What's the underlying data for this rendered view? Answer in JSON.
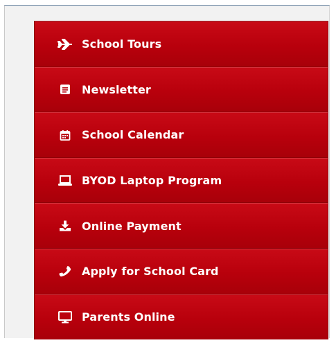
{
  "menu": {
    "items": [
      {
        "label": "School Tours",
        "icon": "airplane-icon"
      },
      {
        "label": "Newsletter",
        "icon": "newspaper-icon"
      },
      {
        "label": "School Calendar",
        "icon": "calendar-icon"
      },
      {
        "label": "BYOD Laptop Program",
        "icon": "laptop-icon"
      },
      {
        "label": "Online Payment",
        "icon": "download-icon"
      },
      {
        "label": "Apply for School Card",
        "icon": "phone-icon"
      },
      {
        "label": "Parents Online",
        "icon": "monitor-icon"
      }
    ]
  },
  "colors": {
    "menu_background": "#b8000c",
    "menu_text": "#ffffff",
    "panel_background": "#f2f2f2"
  }
}
